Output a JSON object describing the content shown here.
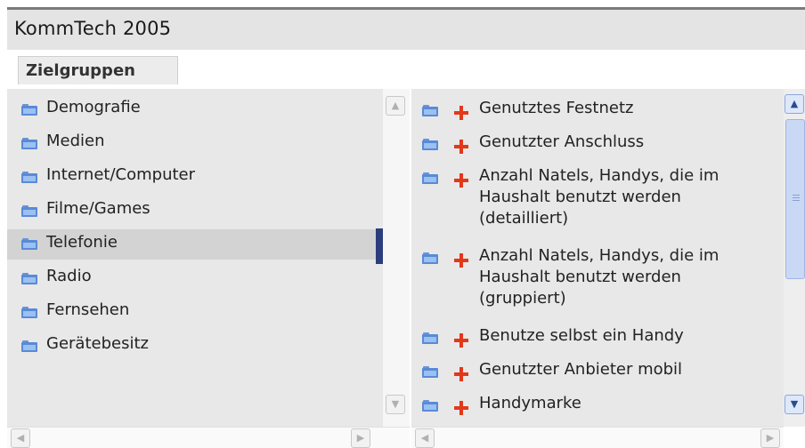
{
  "window": {
    "title": "KommTech 2005"
  },
  "tabs": [
    {
      "label": "Zielgruppen",
      "active": true
    }
  ],
  "categories": [
    {
      "label": "Demografie",
      "icon": "folder-icon"
    },
    {
      "label": "Medien",
      "icon": "folder-icon"
    },
    {
      "label": "Internet/Computer",
      "icon": "folder-icon"
    },
    {
      "label": "Filme/Games",
      "icon": "folder-icon"
    },
    {
      "label": "Telefonie",
      "icon": "folder-icon",
      "selected": true
    },
    {
      "label": "Radio",
      "icon": "folder-icon"
    },
    {
      "label": "Fernsehen",
      "icon": "folder-icon"
    },
    {
      "label": "Gerätebesitz",
      "icon": "folder-icon"
    }
  ],
  "variables": [
    {
      "label": "Genutztes Festnetz",
      "icon": "folder-icon",
      "action": "add-icon"
    },
    {
      "label": "Genutzter Anschluss",
      "icon": "folder-icon",
      "action": "add-icon"
    },
    {
      "label": "Anzahl Natels, Handys, die im Haushalt benutzt werden (detailliert)",
      "icon": "folder-icon",
      "action": "add-icon"
    },
    {
      "label": "Anzahl Natels, Handys, die im Haushalt benutzt werden (gruppiert)",
      "icon": "folder-icon",
      "action": "add-icon"
    },
    {
      "label": "Benutze selbst ein Handy",
      "icon": "folder-icon",
      "action": "add-icon"
    },
    {
      "label": "Genutzter Anbieter mobil",
      "icon": "folder-icon",
      "action": "add-icon"
    },
    {
      "label": "Handymarke",
      "icon": "folder-icon",
      "action": "add-icon"
    }
  ],
  "colors": {
    "selection_bar": "#2b3d7d",
    "add_icon": "#e2381b",
    "folder": "#5a8ad6",
    "panel_bg": "#e8e8e8"
  }
}
